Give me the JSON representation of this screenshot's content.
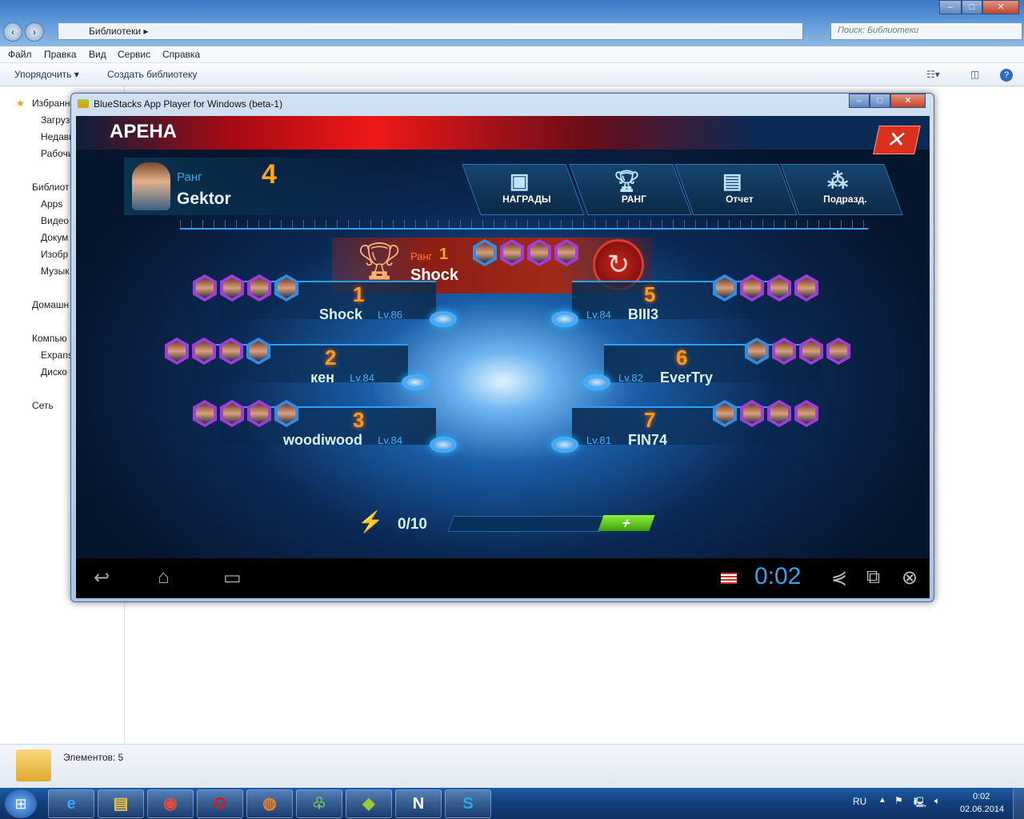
{
  "explorer": {
    "address": {
      "crumb": "Библиотеки",
      "search_placeholder": "Поиск: Библиотеки"
    },
    "menu": [
      "Файл",
      "Правка",
      "Вид",
      "Сервис",
      "Справка"
    ],
    "toolbar": {
      "organize": "Упорядочить ▾",
      "create_library": "Создать библиотеку"
    },
    "nav": [
      "Избранн",
      "Загрузк",
      "Недавн",
      "Рабочи",
      "Библиот",
      "Apps",
      "Видео",
      "Докум",
      "Изобр",
      "Музык",
      "Домашн",
      "Компью",
      "Expans",
      "Диско",
      "Сеть"
    ],
    "status": "Элементов: 5"
  },
  "bluestacks": {
    "title": "BlueStacks App Player for Windows (beta-1)",
    "timer": "0:02",
    "game": {
      "title": "АРЕНА",
      "player": {
        "rank_label": "Ранг",
        "rank": "4",
        "name": "Gektor"
      },
      "tabs": [
        {
          "label": "НАГРАДЫ",
          "icon": "gift-box-icon"
        },
        {
          "label": "РАНГ",
          "icon": "trophy-icon"
        },
        {
          "label": "Отчет",
          "icon": "clipboard-icon"
        },
        {
          "label": "Подразд.",
          "icon": "squad-icon"
        }
      ],
      "top": {
        "rank_label": "Ранг",
        "rank": "1",
        "name": "Shock"
      },
      "left": [
        {
          "rank": "1",
          "name": "Shock",
          "level": "Lv.86"
        },
        {
          "rank": "2",
          "name": "кен",
          "level": "Lv.84"
        },
        {
          "rank": "3",
          "name": "woodiwood",
          "level": "Lv.84"
        }
      ],
      "right": [
        {
          "rank": "5",
          "name": "BIII3",
          "level": "Lv.84"
        },
        {
          "rank": "6",
          "name": "EverTry",
          "level": "Lv.82"
        },
        {
          "rank": "7",
          "name": "FIN74",
          "level": "Lv.81"
        }
      ],
      "energy": "0/10",
      "add": "+"
    }
  },
  "taskbar": {
    "lang": "RU",
    "time": "0:02",
    "date": "02.06.2014",
    "apps": [
      "internet-explorer",
      "file-explorer",
      "chrome",
      "opera",
      "firefox",
      "app",
      "bluestacks",
      "nf-game",
      "skype"
    ]
  },
  "colors": {
    "accent_blue": "#2aa0ff",
    "rank_orange": "#ff9a1e",
    "arena_red": "#ef1818"
  }
}
